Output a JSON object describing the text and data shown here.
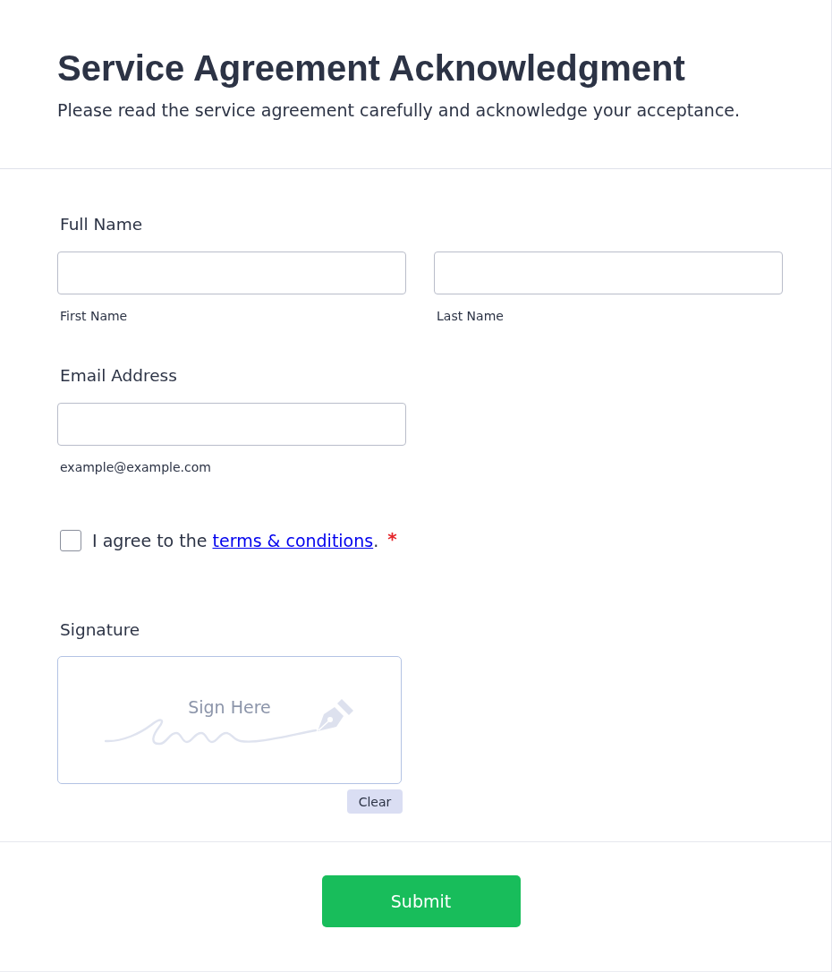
{
  "header": {
    "title": "Service Agreement Acknowledgment",
    "subtitle": "Please read the service agreement carefully and acknowledge your acceptance."
  },
  "fields": [
    {
      "label": "Full Name",
      "inputs": [
        {
          "sublabel": "First Name"
        },
        {
          "sublabel": "Last Name"
        }
      ]
    },
    {
      "label": "Email Address",
      "inputs": [
        {
          "sublabel": "example@example.com"
        }
      ]
    }
  ],
  "agreement": {
    "checked": false,
    "text_before": "I agree to the",
    "link": "terms & conditions",
    "text_after": ".",
    "required_mark": "*"
  },
  "signature": {
    "label": "Signature",
    "placeholder": "Sign Here",
    "clear_button": "Clear"
  },
  "submit_button": "Submit"
}
